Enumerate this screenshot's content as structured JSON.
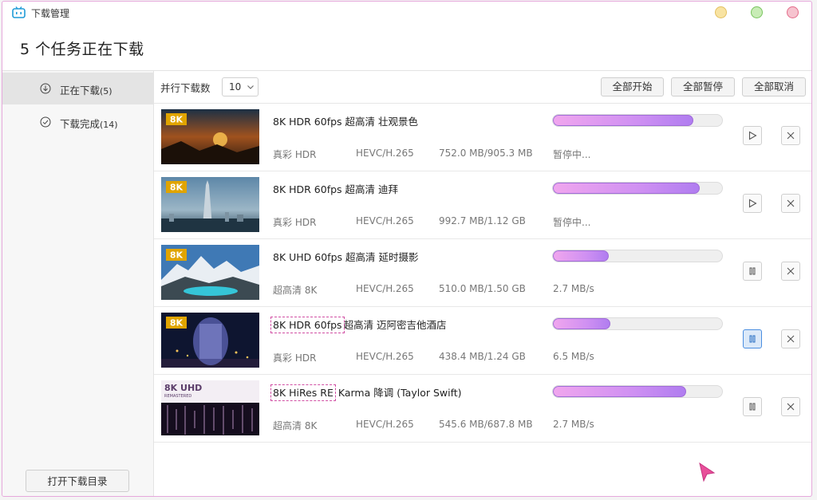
{
  "window": {
    "title": "下载管理",
    "header_title": "5 个任务正在下载"
  },
  "sidebar": {
    "items": [
      {
        "label": "正在下载",
        "count": "(5)",
        "icon": "download-circle-icon",
        "active": true
      },
      {
        "label": "下载完成",
        "count": "(14)",
        "icon": "check-circle-icon",
        "active": false
      }
    ],
    "open_folder_label": "打开下载目录"
  },
  "toolbar": {
    "concurrent_label": "并行下载数",
    "concurrent_value": "10",
    "start_all": "全部开始",
    "pause_all": "全部暂停",
    "cancel_all": "全部取消"
  },
  "tasks": [
    {
      "title_main": "8K HDR 60fps 超高清 壮观景色",
      "quality": "真彩 HDR",
      "codec": "HEVC/H.265",
      "size": "752.0 MB/905.3 MB",
      "status": "暂停中...",
      "progress": 0.83,
      "state": "paused",
      "thumb_badge": "8K"
    },
    {
      "title_main": "8K HDR 60fps 超高清 迪拜",
      "quality": "真彩 HDR",
      "codec": "HEVC/H.265",
      "size": "992.7 MB/1.12 GB",
      "status": "暂停中...",
      "progress": 0.87,
      "state": "paused",
      "thumb_badge": "8K"
    },
    {
      "title_main": "8K UHD 60fps 超高清 延时摄影",
      "quality": "超高清 8K",
      "codec": "HEVC/H.265",
      "size": "510.0 MB/1.50 GB",
      "status": "2.7 MB/s",
      "progress": 0.33,
      "state": "downloading",
      "thumb_badge": "8K"
    },
    {
      "title_prefix": "8K HDR 60fps",
      "title_main": "超高清 迈阿密吉他酒店",
      "quality": "真彩 HDR",
      "codec": "HEVC/H.265",
      "size": "438.4 MB/1.24 GB",
      "status": "6.5 MB/s",
      "progress": 0.34,
      "state": "downloading",
      "thumb_badge": "8K"
    },
    {
      "title_prefix": "8K HiRes RE",
      "title_main": "Karma 降调 (Taylor Swift)",
      "quality": "超高清 8K",
      "codec": "HEVC/H.265",
      "size": "545.6 MB/687.8 MB",
      "status": "2.7 MB/s",
      "progress": 0.79,
      "state": "downloading",
      "thumb_badge": "8K UHD",
      "thumb_sub": "REMASTERED"
    }
  ],
  "colors": {
    "progress_start": "#f0a6ee",
    "progress_end": "#b07df0",
    "focus": "#4a8ee0"
  }
}
